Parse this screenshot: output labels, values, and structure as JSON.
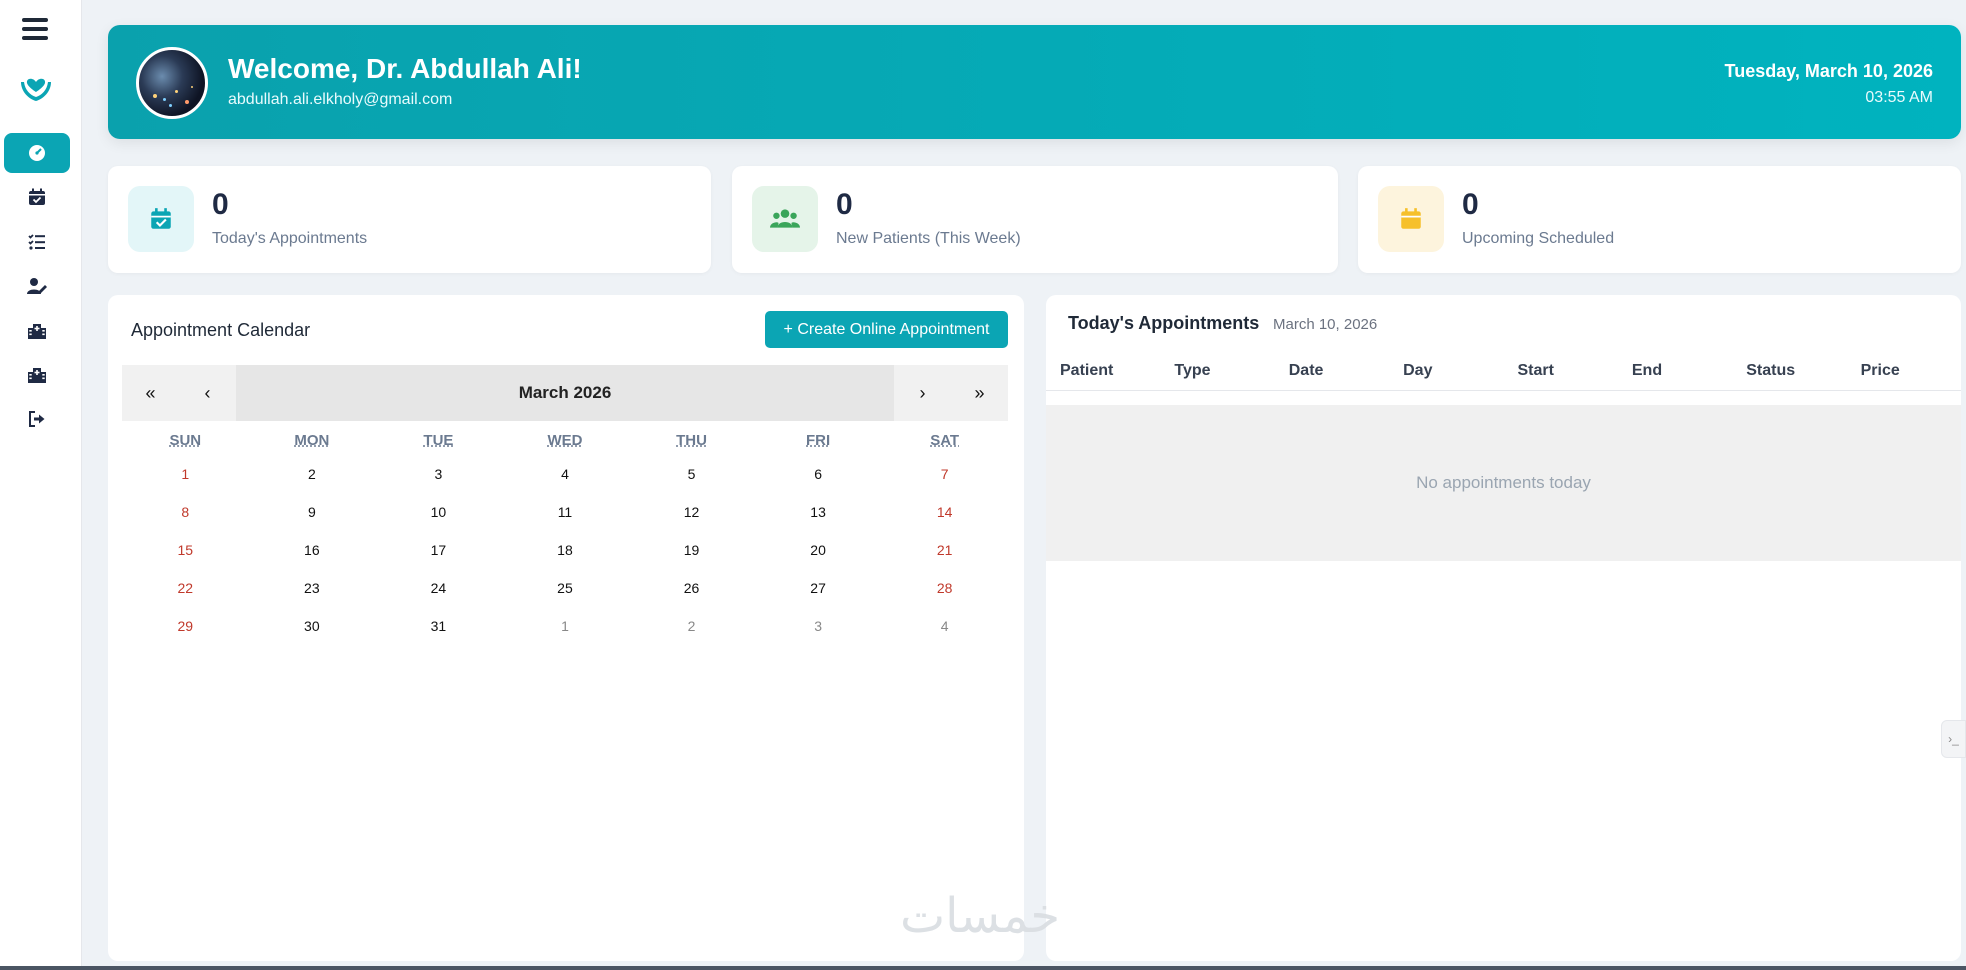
{
  "sidebar": {
    "items": [
      {
        "name": "dashboard",
        "icon": "gauge-icon",
        "active": true
      },
      {
        "name": "appointments",
        "icon": "calendar-check-icon",
        "active": false
      },
      {
        "name": "tasks",
        "icon": "list-check-icon",
        "active": false
      },
      {
        "name": "profile-edit",
        "icon": "user-edit-icon",
        "active": false
      },
      {
        "name": "clinics",
        "icon": "hospital-icon",
        "active": false
      },
      {
        "name": "clinics-2",
        "icon": "hospital-icon",
        "active": false
      },
      {
        "name": "logout",
        "icon": "logout-icon",
        "active": false
      }
    ]
  },
  "header": {
    "welcome": "Welcome, Dr. Abdullah Ali!",
    "email": "abdullah.ali.elkholy@gmail.com",
    "date": "Tuesday, March 10, 2026",
    "time": "03:55 AM"
  },
  "stats": [
    {
      "value": "0",
      "label": "Today's Appointments",
      "icon": "calendar-check-icon",
      "color": "#0ba5b4",
      "bg": "#e3f6f8"
    },
    {
      "value": "0",
      "label": "New Patients (This Week)",
      "icon": "users-icon",
      "color": "#3aa55a",
      "bg": "#e5f4e9"
    },
    {
      "value": "0",
      "label": "Upcoming Scheduled",
      "icon": "calendar-icon",
      "color": "#f6c02b",
      "bg": "#fdf4dd"
    }
  ],
  "calendar": {
    "title": "Appointment Calendar",
    "create_button": "+ Create Online Appointment",
    "month_label": "March 2026",
    "nav": {
      "prev_year": "«",
      "prev_month": "‹",
      "next_month": "›",
      "next_year": "»"
    },
    "weekdays": [
      "SUN",
      "MON",
      "TUE",
      "WED",
      "THU",
      "FRI",
      "SAT"
    ],
    "weeks": [
      [
        "1",
        "2",
        "3",
        "4",
        "5",
        "6",
        "7"
      ],
      [
        "8",
        "9",
        "10",
        "11",
        "12",
        "13",
        "14"
      ],
      [
        "15",
        "16",
        "17",
        "18",
        "19",
        "20",
        "21"
      ],
      [
        "22",
        "23",
        "24",
        "25",
        "26",
        "27",
        "28"
      ],
      [
        "29",
        "30",
        "31",
        "1",
        "2",
        "3",
        "4"
      ]
    ]
  },
  "appointments": {
    "title": "Today's Appointments",
    "date": "March 10, 2026",
    "columns": [
      "Patient",
      "Type",
      "Date",
      "Day",
      "Start",
      "End",
      "Status",
      "Price"
    ],
    "empty_text": "No appointments today"
  },
  "side_tab": "›_"
}
